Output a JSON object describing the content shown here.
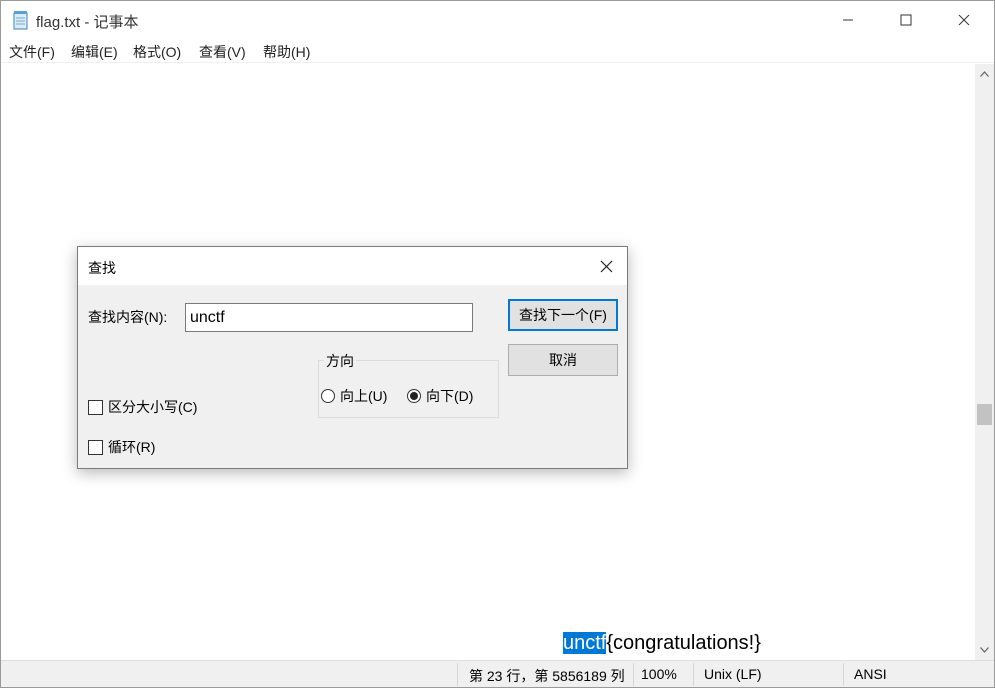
{
  "window": {
    "title": "flag.txt - 记事本",
    "icon": "notepad-icon"
  },
  "menu": {
    "items": [
      "文件(F)",
      "编辑(E)",
      "格式(O)",
      "查看(V)",
      "帮助(H)"
    ]
  },
  "editor": {
    "highlighted_text": "unctf",
    "rest_text": "{congratulations!}"
  },
  "status": {
    "position": "第 23 行，第 5856189 列",
    "zoom": "100%",
    "line_ending": "Unix (LF)",
    "encoding": "ANSI"
  },
  "find_dialog": {
    "title": "查找",
    "find_label": "查找内容(N):",
    "find_value": "unctf",
    "find_next_label": "查找下一个(F)",
    "cancel_label": "取消",
    "direction_label": "方向",
    "up_label": "向上(U)",
    "down_label": "向下(D)",
    "direction_selected": "down",
    "match_case_label": "区分大小写(C)",
    "match_case_checked": false,
    "wrap_label": "循环(R)",
    "wrap_checked": false
  },
  "colors": {
    "selection": "#0078d7",
    "dialog_bg": "#f0f0f0"
  }
}
